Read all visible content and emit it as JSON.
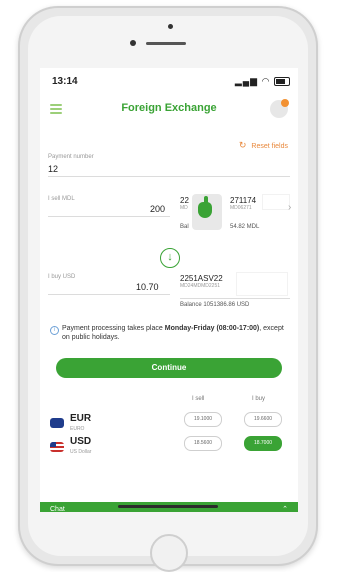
{
  "status": {
    "time": "13:14"
  },
  "header": {
    "title": "Foreign Exchange"
  },
  "reset": {
    "label": "Reset fields"
  },
  "payment": {
    "label": "Payment number",
    "value": "12"
  },
  "sell": {
    "label": "I sell MDL",
    "amount": "200",
    "account_number": "22",
    "account_number_2": "271174",
    "account_sub": "MD",
    "account_sub_2": "MD06271",
    "balance_prefix": "Bal",
    "balance_value": "54.82 MDL"
  },
  "buy": {
    "label": "I buy USD",
    "amount": "10.70",
    "account_number": "2251ASV22",
    "account_sub": "MD24MDMD2251",
    "balance": "Balance 1051386.86 USD"
  },
  "info": {
    "text_1": "Payment processing takes place ",
    "text_bold": "Monday-Friday (08:00-17:00)",
    "text_2": ", except on public holidays."
  },
  "continue_label": "Continue",
  "rates": {
    "sell_header": "I sell",
    "buy_header": "I buy",
    "rows": [
      {
        "code": "EUR",
        "name": "EURO",
        "sell": "19.1000",
        "buy": "19.6600"
      },
      {
        "code": "USD",
        "name": "US Dollar",
        "sell": "18.5600",
        "buy": "18.7000"
      }
    ]
  },
  "chat": {
    "label": "Chat"
  },
  "colors": {
    "accent": "#3aa335",
    "orange": "#e8873a"
  }
}
